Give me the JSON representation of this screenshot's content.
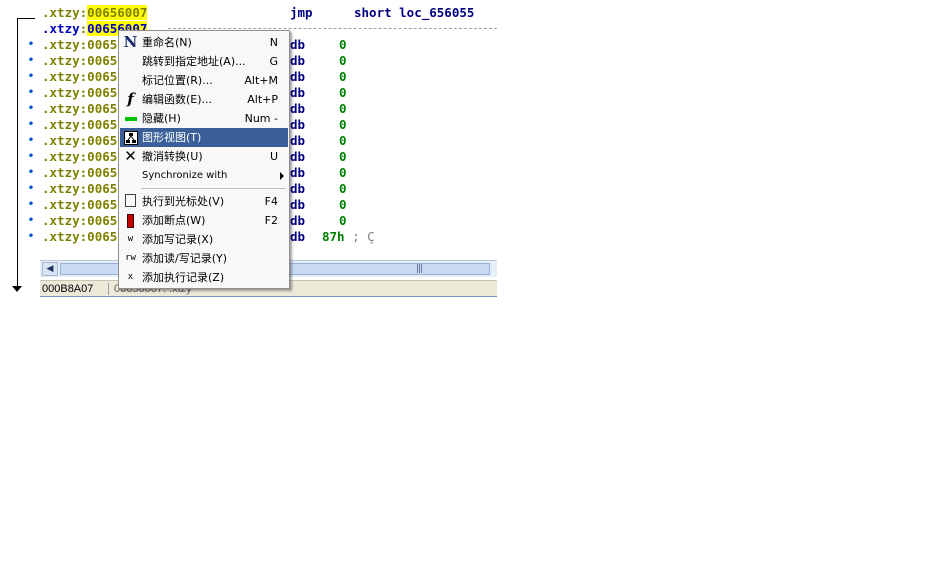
{
  "disassembly": {
    "rows": [
      {
        "seg": ".xtzy",
        "addr": "00656007",
        "mnem": "jmp",
        "oper": "short loc_656055"
      },
      {
        "seg": ".xtzy",
        "addr": "00656007"
      },
      {
        "seg": ".xtzy",
        "addr": "0065",
        "mnem": "db",
        "oper": "0"
      },
      {
        "seg": ".xtzy",
        "addr": "0065",
        "mnem": "db",
        "oper": "0"
      },
      {
        "seg": ".xtzy",
        "addr": "0065",
        "mnem": "db",
        "oper": "0"
      },
      {
        "seg": ".xtzy",
        "addr": "0065",
        "mnem": "db",
        "oper": "0"
      },
      {
        "seg": ".xtzy",
        "addr": "0065",
        "mnem": "db",
        "oper": "0"
      },
      {
        "seg": ".xtzy",
        "addr": "0065",
        "mnem": "db",
        "oper": "0"
      },
      {
        "seg": ".xtzy",
        "addr": "0065",
        "mnem": "db",
        "oper": "0"
      },
      {
        "seg": ".xtzy",
        "addr": "0065",
        "mnem": "db",
        "oper": "0"
      },
      {
        "seg": ".xtzy",
        "addr": "0065",
        "mnem": "db",
        "oper": "0"
      },
      {
        "seg": ".xtzy",
        "addr": "0065",
        "mnem": "db",
        "oper": "0"
      },
      {
        "seg": ".xtzy",
        "addr": "0065",
        "mnem": "db",
        "oper": "0"
      },
      {
        "seg": ".xtzy",
        "addr": "0065",
        "mnem": "db",
        "oper": "0"
      },
      {
        "seg": ".xtzy",
        "addr": "0065",
        "mnem": "db",
        "oper": "87h",
        "comment": "; Ç"
      }
    ],
    "colon": ":",
    "grip": "|||"
  },
  "statusbar": {
    "offset": "000B8A07",
    "address": "00656007: .xtzy"
  },
  "context_menu": {
    "items": [
      {
        "label": "重命名(N)",
        "key": "N",
        "icon": "rename-icon"
      },
      {
        "label": "跳转到指定地址(A)...",
        "key": "G",
        "icon": ""
      },
      {
        "label": "标记位置(R)...",
        "key": "Alt+M",
        "icon": ""
      },
      {
        "label": "编辑函数(E)...",
        "key": "Alt+P",
        "icon": "function-icon"
      },
      {
        "label": "隐藏(H)",
        "key": "Num -",
        "icon": "hide-icon"
      },
      {
        "label": "图形视图(T)",
        "key": "",
        "icon": "graph-view-icon"
      },
      {
        "label": "撤消转换(U)",
        "key": "U",
        "icon": "undo-icon"
      },
      {
        "label": "Synchronize with",
        "key": "",
        "icon": ""
      },
      {
        "label": "执行到光标处(V)",
        "key": "F4",
        "icon": "run-to-cursor-icon"
      },
      {
        "label": "添加断点(W)",
        "key": "F2",
        "icon": "breakpoint-icon"
      },
      {
        "label": "添加写记录(X)",
        "key": "",
        "icon": "write-trace-icon"
      },
      {
        "label": "添加读/写记录(Y)",
        "key": "",
        "icon": "rw-trace-icon"
      },
      {
        "label": "添加执行记录(Z)",
        "key": "",
        "icon": "exec-trace-icon"
      }
    ],
    "icon_glyphs": {
      "rename": "N",
      "function": "f",
      "undo": "✕",
      "write": "w",
      "rw": "rw",
      "exec": "x"
    },
    "selected_index": 5,
    "selected_color": "#3a5f98"
  }
}
